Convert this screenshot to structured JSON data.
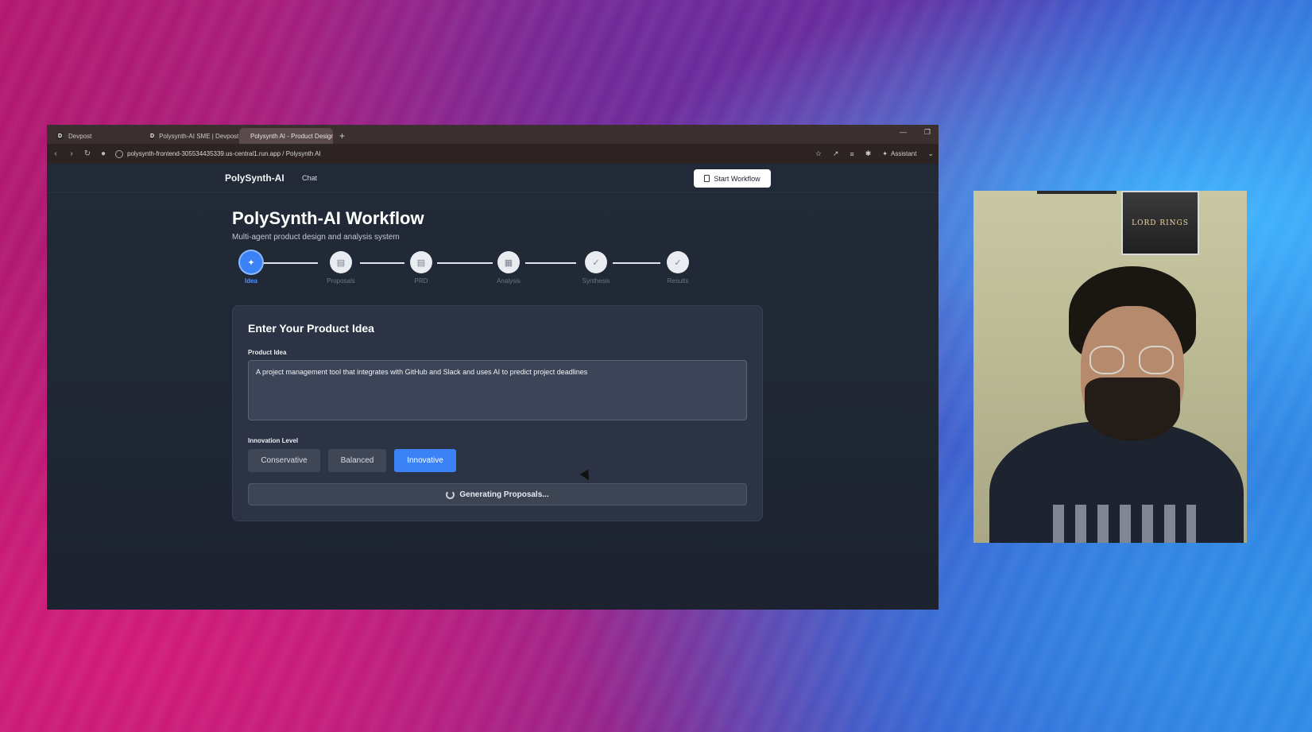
{
  "browser": {
    "tabs": [
      {
        "label": "Devpost",
        "icon": "D",
        "active": false
      },
      {
        "label": "Polysynth-AI SME | Devpost",
        "icon": "D",
        "active": false
      },
      {
        "label": "Polysynth AI - Product Design",
        "icon": "globe",
        "active": true
      }
    ],
    "url": "polysynth-frontend-305534435339.us-central1.run.app / Polysynth AI",
    "assistant_label": "Assistant"
  },
  "app": {
    "brand": "PolySynth-AI",
    "nav_chat": "Chat",
    "start_workflow_label": "Start Workflow",
    "title": "PolySynth-AI Workflow",
    "subtitle": "Multi-agent product design and analysis system",
    "steps": [
      {
        "label": "Idea",
        "icon": "sparkle-icon",
        "active": true
      },
      {
        "label": "Proposals",
        "icon": "document-icon",
        "active": false
      },
      {
        "label": "PRD",
        "icon": "document-icon",
        "active": false
      },
      {
        "label": "Analysis",
        "icon": "bar-chart-icon",
        "active": false
      },
      {
        "label": "Synthesis",
        "icon": "check-circle-icon",
        "active": false
      },
      {
        "label": "Results",
        "icon": "check-circle-icon",
        "active": false
      }
    ],
    "card": {
      "title": "Enter Your Product Idea",
      "product_idea_label": "Product Idea",
      "product_idea_value": "A project management tool that integrates with GitHub and Slack and uses AI to predict project deadlines",
      "innovation_label": "Innovation Level",
      "levels": [
        "Conservative",
        "Balanced",
        "Innovative"
      ],
      "selected_level": "Innovative",
      "generate_label": "Generating Proposals..."
    }
  },
  "webcam": {
    "poster_text": "LORD RINGS"
  },
  "colors": {
    "accent": "#3b82f6",
    "app_bg": "#1f2634",
    "card_bg": "#2b3344"
  }
}
